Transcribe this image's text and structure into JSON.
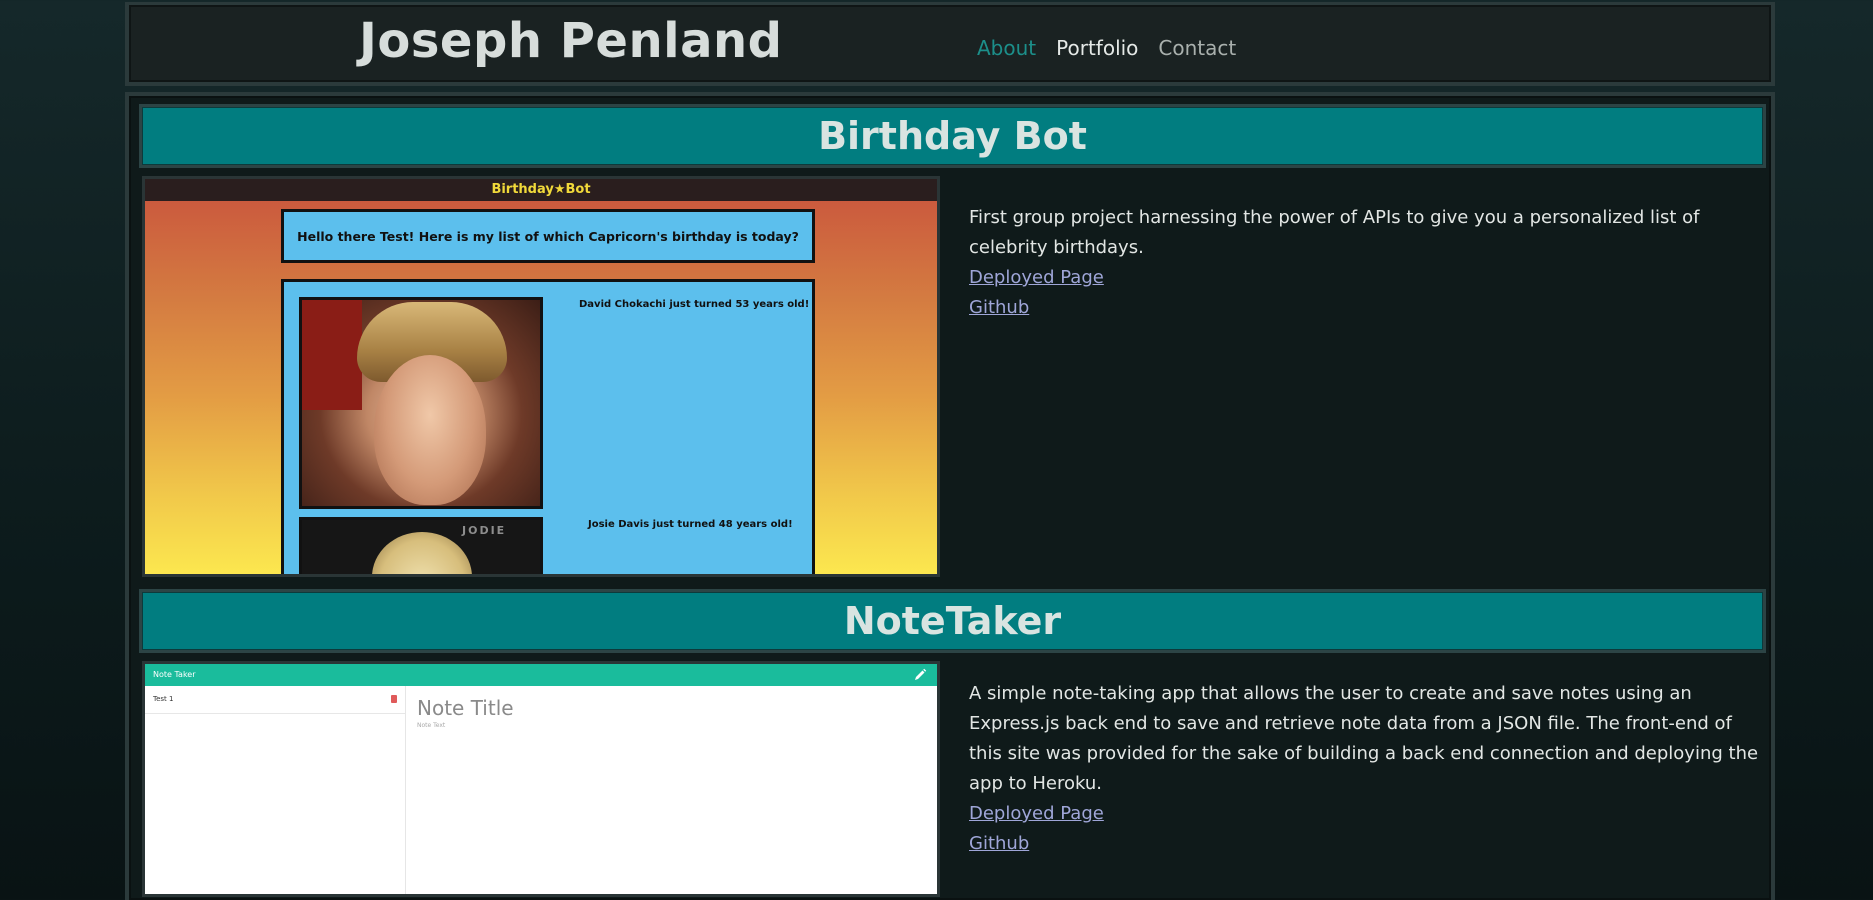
{
  "header": {
    "site_title": "Joseph Penland",
    "nav": [
      {
        "label": "About",
        "active": true
      },
      {
        "label": "Portfolio"
      },
      {
        "label": "Contact"
      }
    ]
  },
  "projects": [
    {
      "title": "Birthday Bot",
      "description": "First group project harnessing the power of APIs to give you a personalized list of celebrity birthdays.",
      "links": [
        "Deployed Page",
        "Github"
      ],
      "screenshot": {
        "app_title": "Birthday★Bot",
        "greeting": "Hello there Test! Here is my list of which Capricorn's birthday is today?",
        "entries": [
          "David Chokachi just turned 53 years old!",
          "Josie Davis just turned 48 years old!"
        ],
        "wall_text": "JODIE"
      }
    },
    {
      "title": "NoteTaker",
      "description": "A simple note-taking app that allows the user to create and save notes using an Express.js back end to save and retrieve note data from a JSON file. The front-end of this site was provided for the sake of building a back end connection and deploying the app to Heroku.",
      "links": [
        "Deployed Page",
        "Github"
      ],
      "screenshot": {
        "app_title": "Note Taker",
        "list_items": [
          "Test 1"
        ],
        "note_title_placeholder": "Note Title",
        "note_text_placeholder": "Note Text"
      }
    }
  ],
  "colors": {
    "accent_teal": "#017d80",
    "nav_active": "#1c8f8a",
    "link": "#9fa6d8",
    "background": "#0f1a1a"
  }
}
